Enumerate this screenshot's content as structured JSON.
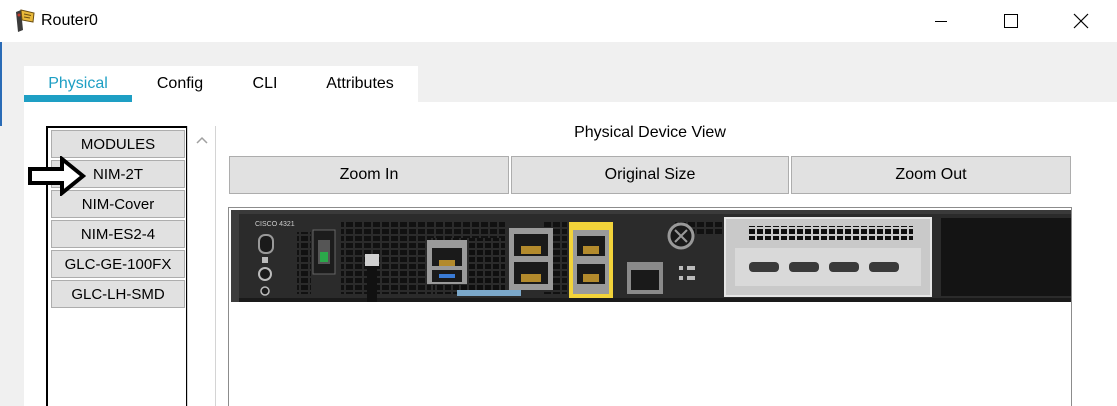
{
  "window": {
    "title": "Router0",
    "controls": [
      "minimize-icon",
      "maximize-icon",
      "close-icon"
    ]
  },
  "tabs": [
    {
      "label": "Physical",
      "active": true
    },
    {
      "label": "Config",
      "active": false
    },
    {
      "label": "CLI",
      "active": false
    },
    {
      "label": "Attributes",
      "active": false
    }
  ],
  "modules": {
    "items": [
      "MODULES",
      "NIM-2T",
      "NIM-Cover",
      "NIM-ES2-4",
      "GLC-GE-100FX",
      "GLC-LH-SMD"
    ],
    "pointed_item": "NIM-2T"
  },
  "device_view": {
    "title": "Physical Device View",
    "buttons": {
      "zoom_in": "Zoom In",
      "original_size": "Original Size",
      "zoom_out": "Zoom Out"
    },
    "chassis_label": "CISCO 4321"
  },
  "colors": {
    "accent": "#1e9fc4",
    "button_face": "#e1e1e1",
    "button_border": "#adadad",
    "chassis": "#2b2b2b",
    "port_highlight": "#f2d33a"
  }
}
